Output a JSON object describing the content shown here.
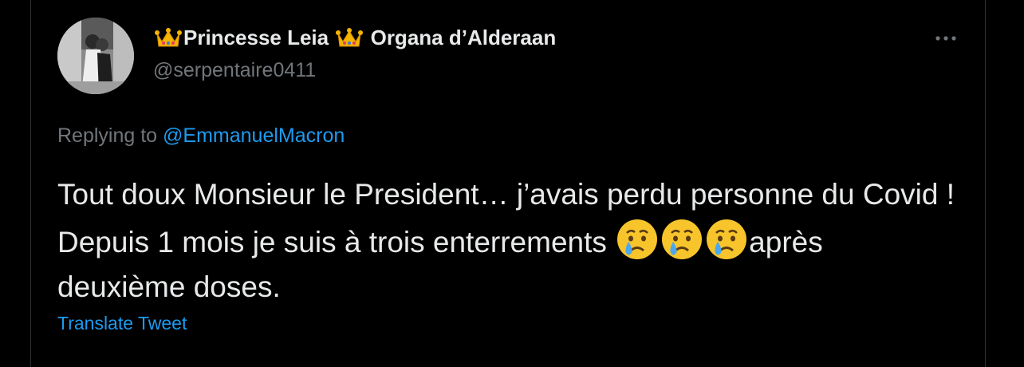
{
  "tweet": {
    "display_name_part1": "Princesse Leia",
    "display_name_part2": "Organa d’Alderaan",
    "handle": "@serpentaire0411",
    "replying_prefix": "Replying to",
    "replying_mention": "@EmmanuelMacron",
    "text_segment_1": "Tout doux Monsieur le President… j’avais perdu personne du Covid ! Depuis 1 mois je suis à trois enterrements ",
    "text_segment_2": "après deuxième doses.",
    "translate_label": "Translate Tweet"
  },
  "icons": {
    "crown": "crown-emoji",
    "crying_face": "crying-face-emoji",
    "more": "more-options-icon"
  },
  "colors": {
    "background": "#000000",
    "text_primary": "#e7e9ea",
    "text_secondary": "#71767b",
    "link": "#1d9bf0",
    "border": "#2f3336"
  }
}
